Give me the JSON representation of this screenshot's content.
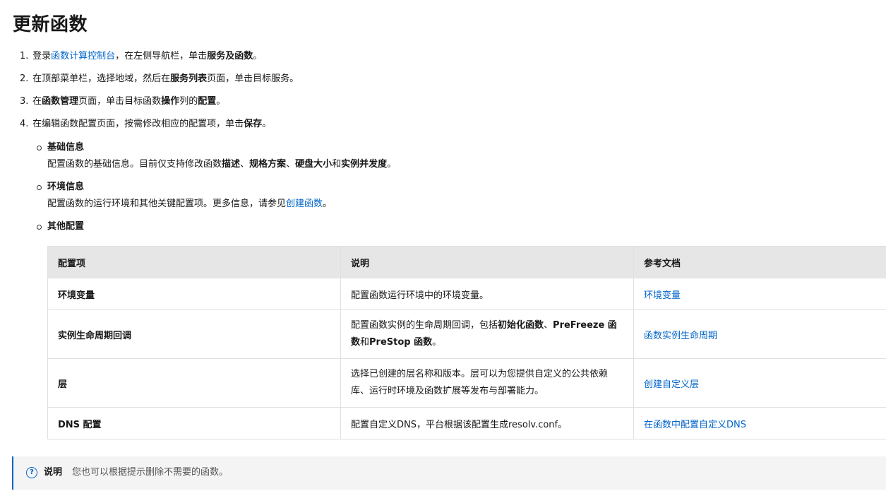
{
  "title": "更新函数",
  "steps": [
    {
      "num": "1.",
      "t1": "登录",
      "link": "函数计算控制台",
      "t2": "，在左侧导航栏，单击",
      "b1": "服务及函数",
      "t3": "。"
    },
    {
      "num": "2.",
      "t1": "在顶部菜单栏，选择地域，然后在",
      "b1": "服务列表",
      "t2": "页面，单击目标服务。"
    },
    {
      "num": "3.",
      "t1": "在",
      "b1": "函数管理",
      "t2": "页面，单击目标函数",
      "b2": "操作",
      "t3": "列的",
      "b3": "配置",
      "t4": "。"
    },
    {
      "num": "4.",
      "t1": "在编辑函数配置页面，按需修改相应的配置项，单击",
      "b1": "保存",
      "t2": "。"
    }
  ],
  "sub": {
    "basic": {
      "title": "基础信息",
      "t1": "配置函数的基础信息。目前仅支持修改函数",
      "b1": "描述",
      "s1": "、",
      "b2": "规格方案",
      "s2": "、",
      "b3": "硬盘大小",
      "s3": "和",
      "b4": "实例并发度",
      "s4": "。"
    },
    "env": {
      "title": "环境信息",
      "t1": "配置函数的运行环境和其他关键配置项。更多信息，请参见",
      "link": "创建函数",
      "t2": "。"
    },
    "other": {
      "title": "其他配置"
    }
  },
  "table": {
    "headers": [
      "配置项",
      "说明",
      "参考文档"
    ],
    "rows": [
      {
        "name": "环境变量",
        "desc": "配置函数运行环境中的环境变量。",
        "doc": "环境变量"
      },
      {
        "name": "实例生命周期回调",
        "desc_a": "配置函数实例的生命周期回调，包括",
        "desc_b1": "初始化函数",
        "desc_s1": "、",
        "desc_b2": "PreFreeze 函数",
        "desc_s2": "和",
        "desc_b3": "PreStop 函数",
        "desc_s3": "。",
        "doc": "函数实例生命周期"
      },
      {
        "name": "层",
        "desc": "选择已创建的层名称和版本。层可以为您提供自定义的公共依赖库、运行时环境及函数扩展等发布与部署能力。",
        "doc": "创建自定义层"
      },
      {
        "name": "DNS 配置",
        "desc": "配置自定义DNS，平台根据该配置生成resolv.conf。",
        "doc": "在函数中配置自定义DNS"
      }
    ]
  },
  "note": {
    "icon": "question-circle-icon",
    "label": "说明",
    "text": "您也可以根据提示删除不需要的函数。"
  },
  "colors": {
    "link": "#0064c8",
    "header_bg": "#e6e6e6",
    "note_bg": "#f4f4f4",
    "note_border": "#0064c8"
  }
}
